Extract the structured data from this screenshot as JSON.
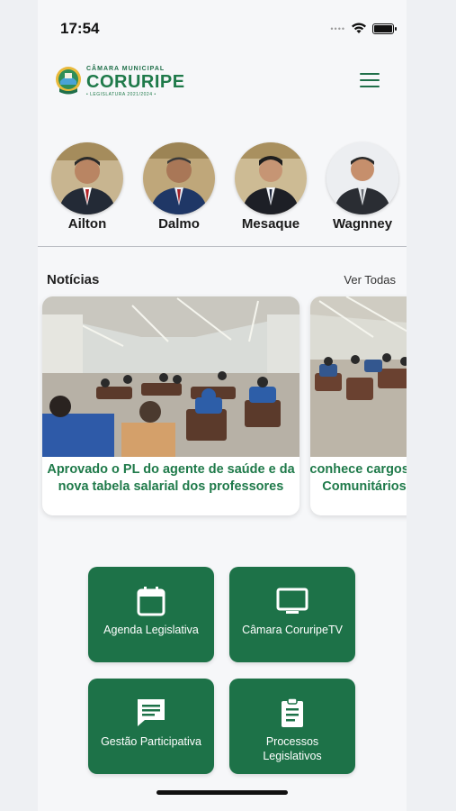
{
  "status": {
    "time": "17:54"
  },
  "header": {
    "logo_top": "CÂMARA MUNICIPAL",
    "logo_main": "CORURIPE",
    "logo_sub": "• LEGISLATURA 2021/2024 •"
  },
  "councilors": [
    {
      "name": "Ailton"
    },
    {
      "name": "Dalmo"
    },
    {
      "name": "Mesaque"
    },
    {
      "name": "Wagnney"
    }
  ],
  "news": {
    "title": "Notícias",
    "see_all": "Ver Todas",
    "items": [
      {
        "headline": "Aprovado o PL do agente de saúde e da nova tabela salarial dos professores"
      },
      {
        "headline": "Câmara reconhece cargos de Agentes Comunitários"
      }
    ]
  },
  "actions": [
    {
      "label": "Agenda Legislativa",
      "icon": "calendar-icon"
    },
    {
      "label": "Câmara CoruripeTV",
      "icon": "tv-icon"
    },
    {
      "label": "Gestão Participativa",
      "icon": "chat-icon"
    },
    {
      "label": "Processos Legislativos",
      "icon": "clipboard-icon"
    }
  ],
  "colors": {
    "brand_green": "#1d7248",
    "headline_green": "#1f7a4a"
  }
}
